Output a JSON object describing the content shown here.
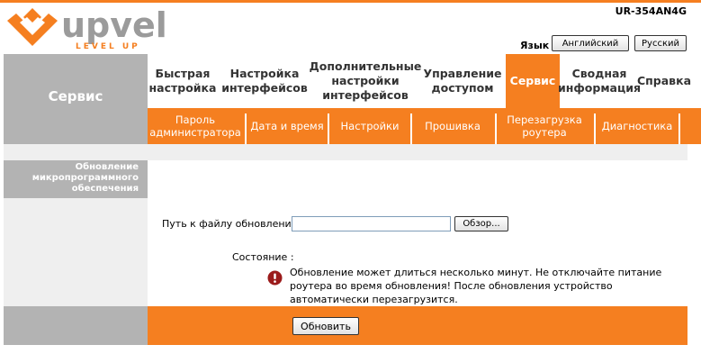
{
  "header": {
    "logo_text": "upvel",
    "logo_sub": "LEVEL UP",
    "model": "UR-354AN4G",
    "lang_label": "Язык",
    "lang_en": "Английский",
    "lang_ru": "Русский"
  },
  "left": {
    "title": "Сервис",
    "section_title": "Обновление микропрограммного обеспечения"
  },
  "menu": {
    "items": [
      {
        "label": "Быстрая настройка"
      },
      {
        "label": "Настройка интерфейсов"
      },
      {
        "label": "Дополнительные настройки интерфейсов"
      },
      {
        "label": "Управление доступом"
      },
      {
        "label": "Сервис"
      },
      {
        "label": "Сводная информация"
      },
      {
        "label": "Справка"
      }
    ],
    "active": "Сервис"
  },
  "submenu": {
    "items": [
      {
        "label": "Пароль администратора"
      },
      {
        "label": "Дата и время"
      },
      {
        "label": "Настройки"
      },
      {
        "label": "Прошивка"
      },
      {
        "label": "Перезагрузка роутера"
      },
      {
        "label": "Диагностика"
      }
    ]
  },
  "form": {
    "path_label": "Путь к файлу обновления :",
    "path_value": "",
    "browse_label": "Обзор...",
    "status_label": "Состояние :",
    "warning_text": "Обновление может длиться несколько минут. Не отключайте питание роутера во время обновления! После обновления устройство автоматически перезагрузится.",
    "update_label": "Обновить"
  },
  "colors": {
    "accent": "#f57f20",
    "panel_gray": "#b3b3b3",
    "warning_red": "#9b1b1b"
  },
  "icons": {
    "logo": "upvel-chevron-logo",
    "warning": "exclamation-circle-icon"
  }
}
